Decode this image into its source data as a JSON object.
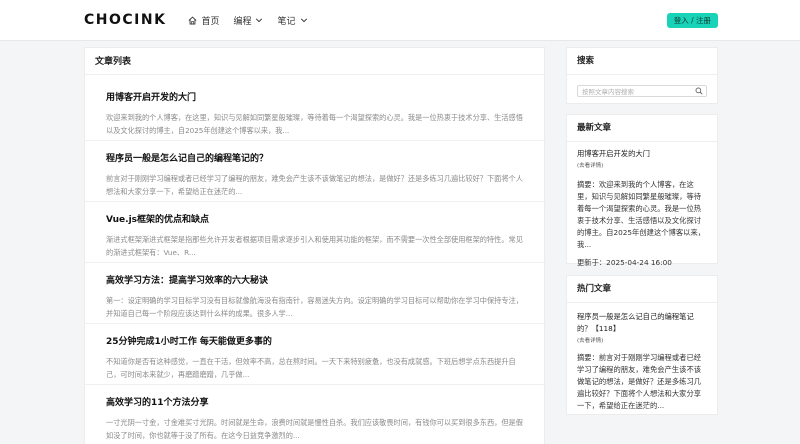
{
  "header": {
    "logo": "CHOCINK",
    "nav": [
      {
        "label": "首页",
        "icon": "home-icon"
      },
      {
        "label": "编程",
        "icon": "chevron-down-icon"
      },
      {
        "label": "笔记",
        "icon": "chevron-down-icon"
      }
    ],
    "login_label": "登入 / 注册"
  },
  "main": {
    "title": "文章列表",
    "articles": [
      {
        "title": "用博客开启开发的大门",
        "summary": "欢迎来到我的个人博客，在这里，知识与见解如同繁星般璀璨，等待着每一个渴望探索的心灵。我是一位热衷于技术分享、生活感悟以及文化探讨的博主，自2025年创建这个博客以来，我..."
      },
      {
        "title": "程序员一般是怎么记自己的编程笔记的？",
        "summary": "前言对于刚刚学习编程或者已经学习了编程的朋友，难免会产生该不该做笔记的想法，是做好？还是多练习几遍比较好？下面将个人想法和大家分享一下，希望给正在迷茫的..."
      },
      {
        "title": "Vue.js框架的优点和缺点",
        "summary": "渐进式框架渐进式框架是指那些允许开发者根据项目需求逐步引入和使用其功能的框架，而不需要一次性全部使用框架的特性。常见的渐进式框架有：Vue、R..."
      },
      {
        "title": "高效学习方法：提高学习效率的六大秘诀",
        "summary": "第一：设定明确的学习目标学习没有目标就像航海没有指南针，容易迷失方向。设定明确的学习目标可以帮助你在学习中保持专注，并知道自己每一个阶段应该达到什么样的成果。很多人学..."
      },
      {
        "title": "25分钟完成1小时工作 每天能做更多事的",
        "summary": "不知道你是否有这种感觉，一直在干活，但效率不高，总在熬时间。一天下来特别疲惫，也没有成就感。下班后想学点东西提升自己，可时间本来就少，再磨蹭磨蹭，几乎做..."
      },
      {
        "title": "高效学习的11个方法分享",
        "summary": "一寸光阴一寸金，寸金难买寸光阴。时间就是生命，浪费时间就是慢性自杀。我们应该敬畏时间，有钱你可以买到很多东西，但是假如没了时间，你也就等于没了所有。在这今日益竞争激烈的..."
      }
    ]
  },
  "sidebar": {
    "search": {
      "title": "搜索",
      "placeholder": "按照文章内容搜索"
    },
    "latest": {
      "title": "最新文章",
      "article_title": "用博客开启开发的大门",
      "link": "(去看详情)",
      "summary": "摘要：欢迎来到我的个人博客，在这里，知识与见解如同繁星般璀璨，等待着每一个渴望探索的心灵。我是一位热衷于技术分享、生活感悟以及文化探讨的博主。自2025年创建这个博客以来，我...",
      "updated": "更新于：2025-04-24 16:00"
    },
    "hot": {
      "title": "热门文章",
      "article_title": "程序员一般是怎么记自己的编程笔记的？【118】",
      "link": "(去看详情)",
      "summary": "摘要：前言对于刚刚学习编程或者已经学习了编程的朋友，难免会产生该不该做笔记的想法，是做好？还是多练习几遍比较好？下面将个人想法和大家分享一下，希望给正在迷茫的..."
    }
  }
}
